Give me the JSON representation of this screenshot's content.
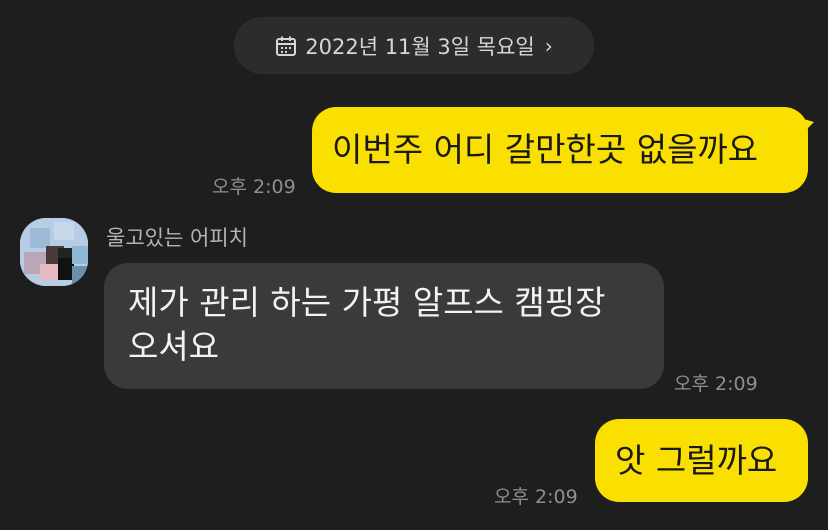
{
  "date_header": {
    "label": "2022년 11월 3일 목요일",
    "chevron": "›",
    "icon": "calendar-icon"
  },
  "messages": [
    {
      "side": "me",
      "text": "이번주 어디 갈만한곳 없을까요",
      "time": "오후 2:09"
    },
    {
      "side": "other",
      "sender": "울고있는 어피치",
      "lines": [
        "제가 관리 하는 가평 알프스 캠핑장",
        "오셔요"
      ],
      "time": "오후 2:09"
    },
    {
      "side": "me",
      "text": "앗 그럴까요",
      "time": "오후 2:09"
    }
  ],
  "colors": {
    "background": "#1e1e1e",
    "my_bubble": "#f9e000",
    "other_bubble": "#3a3a3c",
    "pill": "#2c2c2e"
  }
}
